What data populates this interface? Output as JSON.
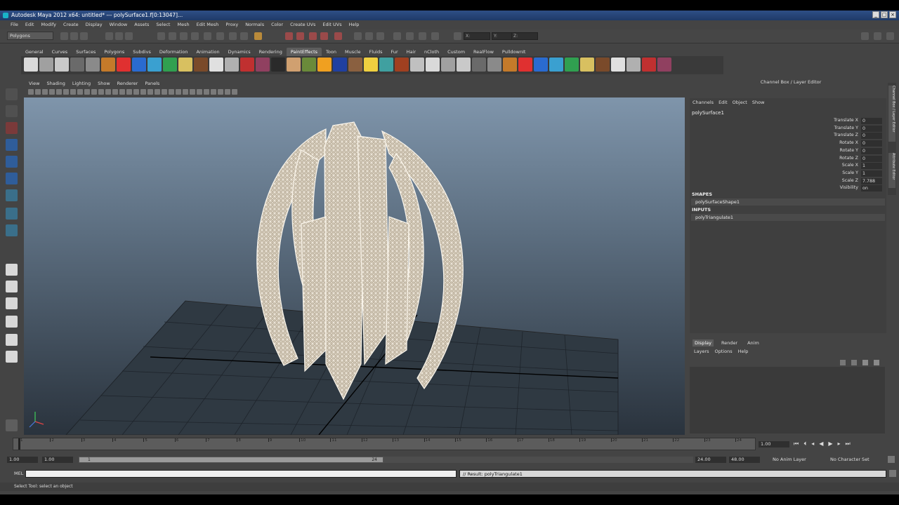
{
  "window": {
    "title": "Autodesk Maya 2012 x64: untitled*   ---   polySurface1.f[0:13047]...",
    "buttons": [
      "_",
      "□",
      "×"
    ]
  },
  "menubar": [
    "File",
    "Edit",
    "Modify",
    "Create",
    "Display",
    "Window",
    "Assets",
    "Select",
    "Mesh",
    "Edit Mesh",
    "Proxy",
    "Normals",
    "Color",
    "Create UVs",
    "Edit UVs",
    "Help"
  ],
  "status_line": {
    "mode": "Polygons",
    "fields": [
      "X:",
      "Y:",
      "Z:"
    ]
  },
  "shelf": {
    "tabs": [
      "General",
      "Curves",
      "Surfaces",
      "Polygons",
      "Subdivs",
      "Deformation",
      "Animation",
      "Dynamics",
      "Rendering",
      "PaintEffects",
      "Toon",
      "Muscle",
      "Fluids",
      "Fur",
      "Hair",
      "nCloth",
      "Custom",
      "RealFlow",
      "PulldownIt"
    ],
    "active_tab": "PaintEffects"
  },
  "viewport": {
    "menus": [
      "View",
      "Shading",
      "Lighting",
      "Show",
      "Renderer",
      "Panels"
    ]
  },
  "channel_box": {
    "header": "Channel Box / Layer Editor",
    "menus": [
      "Channels",
      "Edit",
      "Object",
      "Show"
    ],
    "object": "polySurface1",
    "attributes": [
      {
        "label": "Translate X",
        "value": "0"
      },
      {
        "label": "Translate Y",
        "value": "0"
      },
      {
        "label": "Translate Z",
        "value": "0"
      },
      {
        "label": "Rotate X",
        "value": "0"
      },
      {
        "label": "Rotate Y",
        "value": "0"
      },
      {
        "label": "Rotate Z",
        "value": "0"
      },
      {
        "label": "Scale X",
        "value": "1"
      },
      {
        "label": "Scale Y",
        "value": "1"
      },
      {
        "label": "Scale Z",
        "value": "7.788"
      },
      {
        "label": "Visibility",
        "value": "on"
      }
    ],
    "shapes_label": "SHAPES",
    "shape": "polySurfaceShape1",
    "inputs_label": "INPUTS",
    "input": "polyTriangulate1"
  },
  "side_tabs": [
    "Channel Box / Layer Editor",
    "Attribute Editor"
  ],
  "layer_editor": {
    "tabs": [
      "Display",
      "Render",
      "Anim"
    ],
    "active_tab": "Display",
    "menus": [
      "Layers",
      "Options",
      "Help"
    ]
  },
  "time_slider": {
    "ticks": [
      "1",
      "2",
      "3",
      "4",
      "5",
      "6",
      "7",
      "8",
      "9",
      "10",
      "11",
      "12",
      "13",
      "14",
      "15",
      "16",
      "17",
      "18",
      "19",
      "20",
      "21",
      "22",
      "23",
      "24"
    ],
    "current_frame": "1.00"
  },
  "range_slider": {
    "start": "1.00",
    "inner_start": "1.00",
    "inner_start_marker": "1",
    "inner_end_marker": "24",
    "inner_end": "24.00",
    "end": "48.00",
    "anim_layer": "No Anim Layer",
    "character_set": "No Character Set"
  },
  "command_line": {
    "label": "MEL",
    "result": "// Result: polyTriangulate1"
  },
  "help_line": "Select Tool: select an object",
  "colors": {
    "panel": "#444444",
    "titlebar": "#2e4f86",
    "viewport_top": "#7f95ab",
    "mesh": "#e6dccb"
  }
}
